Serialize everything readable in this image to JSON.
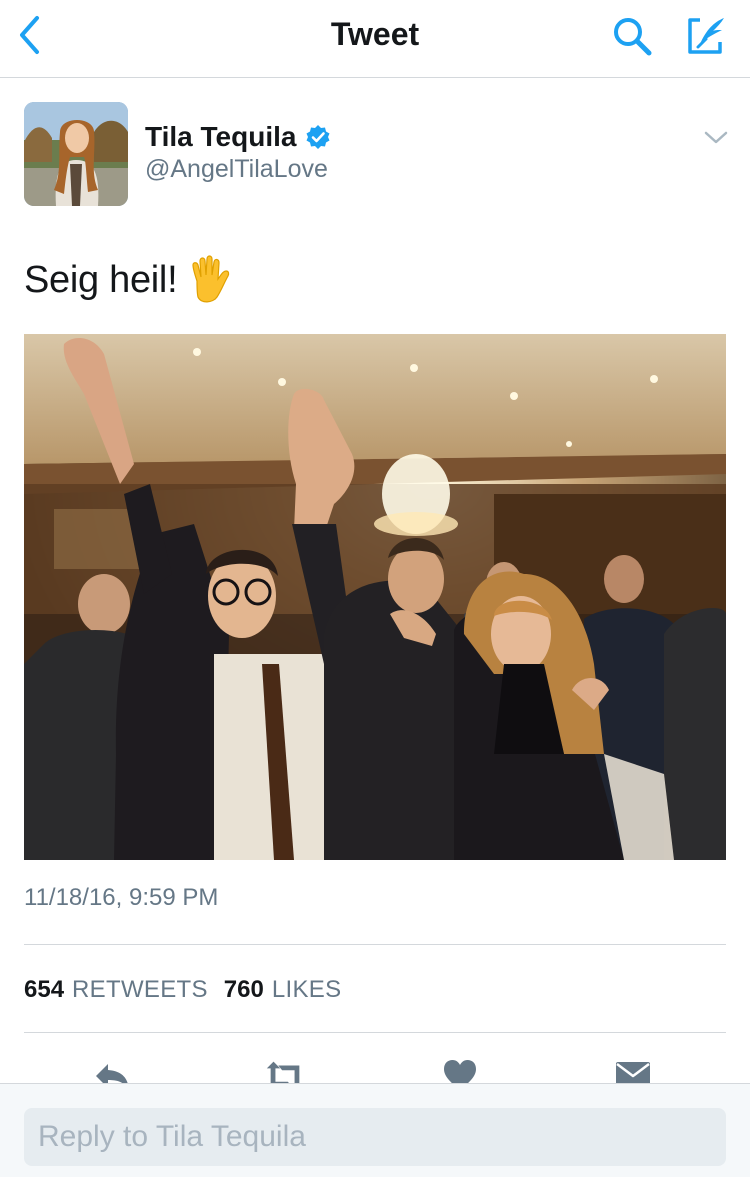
{
  "nav": {
    "title": "Tweet",
    "back_icon": "chevron-left-icon",
    "search_icon": "search-icon",
    "compose_icon": "compose-icon",
    "accent_color": "#1da1f2"
  },
  "author": {
    "name": "Tila Tequila",
    "handle": "@AngelTilaLove",
    "verified": true,
    "verified_color": "#1da1f2"
  },
  "tweet": {
    "text": "Seig heil!",
    "emoji": "raised-hand-icon",
    "timestamp": "11/18/16, 9:59 PM"
  },
  "stats": {
    "retweets_count": "654",
    "retweets_label": "RETWEETS",
    "likes_count": "760",
    "likes_label": "LIKES"
  },
  "actions": [
    "reply-icon",
    "retweet-icon",
    "like-icon",
    "message-icon"
  ],
  "reply": {
    "placeholder": "Reply to Tila Tequila"
  }
}
